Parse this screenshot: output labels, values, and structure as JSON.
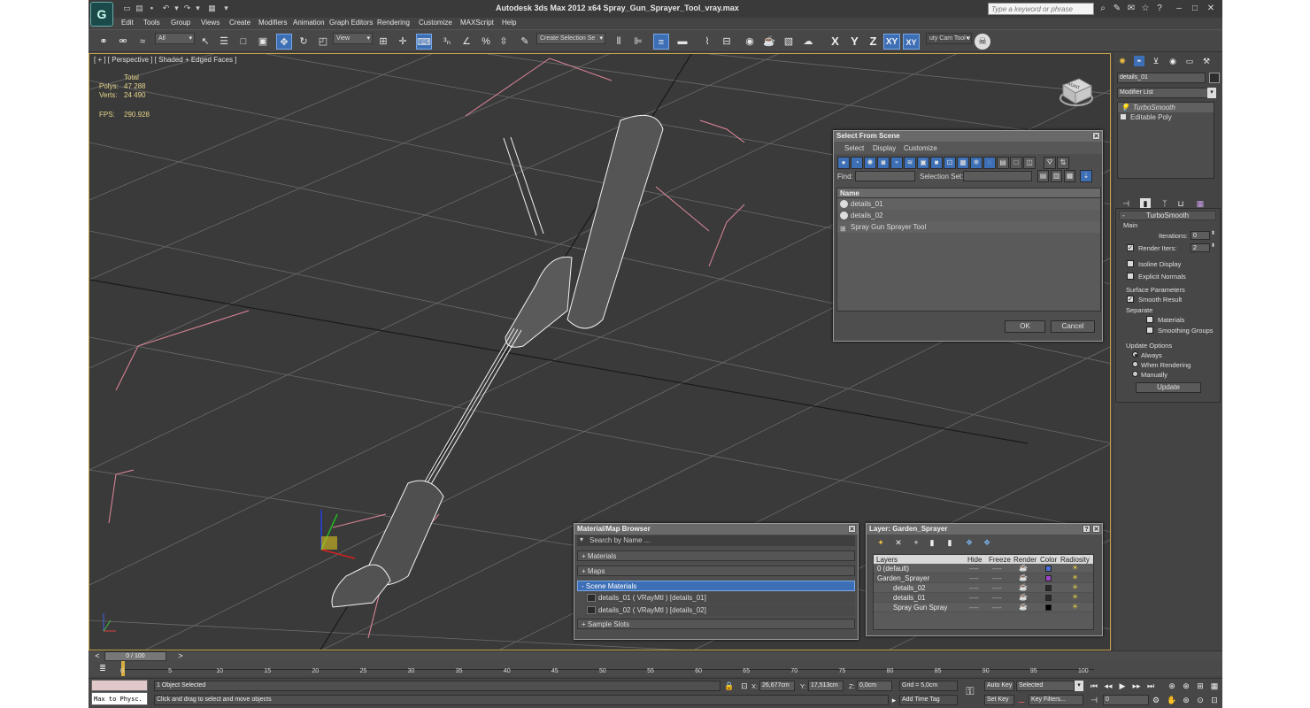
{
  "window": {
    "title": "Autodesk 3ds Max  2012 x64       Spray_Gun_Sprayer_Tool_vray.max",
    "search_placeholder": "Type a keyword or phrase"
  },
  "menu": [
    "Edit",
    "Tools",
    "Group",
    "Views",
    "Create",
    "Modifiers",
    "Animation",
    "Graph Editors",
    "Rendering",
    "Customize",
    "MAXScript",
    "Help"
  ],
  "toolbar": {
    "filter_combo": "All",
    "ref_coord_combo": "View",
    "selection_set_combo": "Create Selection Se",
    "axes": [
      "X",
      "Y",
      "Z",
      "XY"
    ],
    "active_axis": "XY",
    "cam_tool_label": "uty Cam Tool v"
  },
  "viewport": {
    "label": "[ + ] [ Perspective ] [ Shaded + Edged Faces ]",
    "stats": {
      "header": "Total",
      "polys_label": "Polys:",
      "polys": "47 288",
      "verts_label": "Verts:",
      "verts": "24 490",
      "fps_label": "FPS:",
      "fps": "290.928"
    },
    "viewcube_label": "FRONT"
  },
  "select_from_scene": {
    "title": "Select From Scene",
    "menu": [
      "Select",
      "Display",
      "Customize"
    ],
    "find_label": "Find:",
    "selection_set_label": "Selection Set:",
    "column_name": "Name",
    "items": [
      "details_01",
      "details_02",
      "Spray Gun Sprayer Tool"
    ],
    "ok": "OK",
    "cancel": "Cancel"
  },
  "material_browser": {
    "title": "Material/Map Browser",
    "search_placeholder": "Search by Name ...",
    "groups": [
      "+ Materials",
      "+ Maps",
      "- Scene Materials",
      "+ Sample Slots"
    ],
    "scene_materials": [
      "details_01  ( VRayMtl )  [details_01]",
      "details_02  ( VRayMtl )  [details_02]"
    ]
  },
  "layer_dialog": {
    "title": "Layer: Garden_Sprayer",
    "help": "?",
    "columns": [
      "Layers",
      "Hide",
      "Freeze",
      "Render",
      "Color",
      "Radiosity"
    ],
    "rows": [
      {
        "name": "0 (default)",
        "hide": "----",
        "freeze": "----",
        "color": "#4a72d8"
      },
      {
        "name": "Garden_Sprayer",
        "hide": "----",
        "freeze": "----",
        "color": "#9a44c8"
      },
      {
        "name": "details_02",
        "hide": "----",
        "freeze": "----",
        "color": "#2b2b2b"
      },
      {
        "name": "details_01",
        "hide": "----",
        "freeze": "----",
        "color": "#2b2b2b"
      },
      {
        "name": "Spray Gun Spray",
        "hide": "----",
        "freeze": "----",
        "color": "#000000"
      }
    ]
  },
  "command_panel": {
    "object_name": "details_01",
    "modifier_list": "Modifier List",
    "stack": [
      "TurboSmooth",
      "Editable Poly"
    ],
    "rollout_title": "TurboSmooth",
    "main_label": "Main",
    "iterations_label": "Iterations:",
    "iterations": "0",
    "render_iters_label": "Render Iters:",
    "render_iters": "2",
    "isoline_label": "Isoline Display",
    "explicit_normals_label": "Explicit Normals",
    "surface_params_label": "Surface Parameters",
    "smooth_result_label": "Smooth Result",
    "separate_label": "Separate",
    "materials_label": "Materials",
    "smoothing_groups_label": "Smoothing Groups",
    "update_options_label": "Update Options",
    "always_label": "Always",
    "when_rendering_label": "When Rendering",
    "manually_label": "Manually",
    "update_button": "Update"
  },
  "timeline": {
    "frame_counter": "0 / 100",
    "ticks": [
      "0",
      "5",
      "10",
      "15",
      "20",
      "25",
      "30",
      "35",
      "40",
      "45",
      "50",
      "55",
      "60",
      "65",
      "70",
      "75",
      "80",
      "85",
      "90",
      "95",
      "100"
    ]
  },
  "status": {
    "listener": "Max to Physc.",
    "selection": "1 Object Selected",
    "prompt": "Click and drag to select and move objects",
    "x_label": "X:",
    "x": "26,677cm",
    "y_label": "Y:",
    "y": "17,513cm",
    "z_label": "Z:",
    "z": "0,0cm",
    "grid": "Grid = 5,0cm",
    "add_time_tag": "Add Time Tag",
    "auto_key": "Auto Key",
    "set_key": "Set Key",
    "key_mode": "Selected",
    "key_filters": "Key Filters...",
    "current_frame": "0"
  }
}
